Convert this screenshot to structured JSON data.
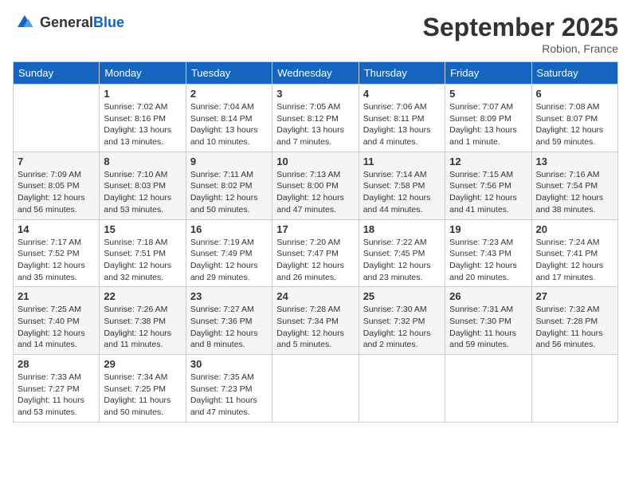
{
  "header": {
    "logo_general": "General",
    "logo_blue": "Blue",
    "month_title": "September 2025",
    "location": "Robion, France"
  },
  "days_of_week": [
    "Sunday",
    "Monday",
    "Tuesday",
    "Wednesday",
    "Thursday",
    "Friday",
    "Saturday"
  ],
  "weeks": [
    [
      {
        "day": "",
        "sunrise": "",
        "sunset": "",
        "daylight": ""
      },
      {
        "day": "1",
        "sunrise": "Sunrise: 7:02 AM",
        "sunset": "Sunset: 8:16 PM",
        "daylight": "Daylight: 13 hours and 13 minutes."
      },
      {
        "day": "2",
        "sunrise": "Sunrise: 7:04 AM",
        "sunset": "Sunset: 8:14 PM",
        "daylight": "Daylight: 13 hours and 10 minutes."
      },
      {
        "day": "3",
        "sunrise": "Sunrise: 7:05 AM",
        "sunset": "Sunset: 8:12 PM",
        "daylight": "Daylight: 13 hours and 7 minutes."
      },
      {
        "day": "4",
        "sunrise": "Sunrise: 7:06 AM",
        "sunset": "Sunset: 8:11 PM",
        "daylight": "Daylight: 13 hours and 4 minutes."
      },
      {
        "day": "5",
        "sunrise": "Sunrise: 7:07 AM",
        "sunset": "Sunset: 8:09 PM",
        "daylight": "Daylight: 13 hours and 1 minute."
      },
      {
        "day": "6",
        "sunrise": "Sunrise: 7:08 AM",
        "sunset": "Sunset: 8:07 PM",
        "daylight": "Daylight: 12 hours and 59 minutes."
      }
    ],
    [
      {
        "day": "7",
        "sunrise": "Sunrise: 7:09 AM",
        "sunset": "Sunset: 8:05 PM",
        "daylight": "Daylight: 12 hours and 56 minutes."
      },
      {
        "day": "8",
        "sunrise": "Sunrise: 7:10 AM",
        "sunset": "Sunset: 8:03 PM",
        "daylight": "Daylight: 12 hours and 53 minutes."
      },
      {
        "day": "9",
        "sunrise": "Sunrise: 7:11 AM",
        "sunset": "Sunset: 8:02 PM",
        "daylight": "Daylight: 12 hours and 50 minutes."
      },
      {
        "day": "10",
        "sunrise": "Sunrise: 7:13 AM",
        "sunset": "Sunset: 8:00 PM",
        "daylight": "Daylight: 12 hours and 47 minutes."
      },
      {
        "day": "11",
        "sunrise": "Sunrise: 7:14 AM",
        "sunset": "Sunset: 7:58 PM",
        "daylight": "Daylight: 12 hours and 44 minutes."
      },
      {
        "day": "12",
        "sunrise": "Sunrise: 7:15 AM",
        "sunset": "Sunset: 7:56 PM",
        "daylight": "Daylight: 12 hours and 41 minutes."
      },
      {
        "day": "13",
        "sunrise": "Sunrise: 7:16 AM",
        "sunset": "Sunset: 7:54 PM",
        "daylight": "Daylight: 12 hours and 38 minutes."
      }
    ],
    [
      {
        "day": "14",
        "sunrise": "Sunrise: 7:17 AM",
        "sunset": "Sunset: 7:52 PM",
        "daylight": "Daylight: 12 hours and 35 minutes."
      },
      {
        "day": "15",
        "sunrise": "Sunrise: 7:18 AM",
        "sunset": "Sunset: 7:51 PM",
        "daylight": "Daylight: 12 hours and 32 minutes."
      },
      {
        "day": "16",
        "sunrise": "Sunrise: 7:19 AM",
        "sunset": "Sunset: 7:49 PM",
        "daylight": "Daylight: 12 hours and 29 minutes."
      },
      {
        "day": "17",
        "sunrise": "Sunrise: 7:20 AM",
        "sunset": "Sunset: 7:47 PM",
        "daylight": "Daylight: 12 hours and 26 minutes."
      },
      {
        "day": "18",
        "sunrise": "Sunrise: 7:22 AM",
        "sunset": "Sunset: 7:45 PM",
        "daylight": "Daylight: 12 hours and 23 minutes."
      },
      {
        "day": "19",
        "sunrise": "Sunrise: 7:23 AM",
        "sunset": "Sunset: 7:43 PM",
        "daylight": "Daylight: 12 hours and 20 minutes."
      },
      {
        "day": "20",
        "sunrise": "Sunrise: 7:24 AM",
        "sunset": "Sunset: 7:41 PM",
        "daylight": "Daylight: 12 hours and 17 minutes."
      }
    ],
    [
      {
        "day": "21",
        "sunrise": "Sunrise: 7:25 AM",
        "sunset": "Sunset: 7:40 PM",
        "daylight": "Daylight: 12 hours and 14 minutes."
      },
      {
        "day": "22",
        "sunrise": "Sunrise: 7:26 AM",
        "sunset": "Sunset: 7:38 PM",
        "daylight": "Daylight: 12 hours and 11 minutes."
      },
      {
        "day": "23",
        "sunrise": "Sunrise: 7:27 AM",
        "sunset": "Sunset: 7:36 PM",
        "daylight": "Daylight: 12 hours and 8 minutes."
      },
      {
        "day": "24",
        "sunrise": "Sunrise: 7:28 AM",
        "sunset": "Sunset: 7:34 PM",
        "daylight": "Daylight: 12 hours and 5 minutes."
      },
      {
        "day": "25",
        "sunrise": "Sunrise: 7:30 AM",
        "sunset": "Sunset: 7:32 PM",
        "daylight": "Daylight: 12 hours and 2 minutes."
      },
      {
        "day": "26",
        "sunrise": "Sunrise: 7:31 AM",
        "sunset": "Sunset: 7:30 PM",
        "daylight": "Daylight: 11 hours and 59 minutes."
      },
      {
        "day": "27",
        "sunrise": "Sunrise: 7:32 AM",
        "sunset": "Sunset: 7:28 PM",
        "daylight": "Daylight: 11 hours and 56 minutes."
      }
    ],
    [
      {
        "day": "28",
        "sunrise": "Sunrise: 7:33 AM",
        "sunset": "Sunset: 7:27 PM",
        "daylight": "Daylight: 11 hours and 53 minutes."
      },
      {
        "day": "29",
        "sunrise": "Sunrise: 7:34 AM",
        "sunset": "Sunset: 7:25 PM",
        "daylight": "Daylight: 11 hours and 50 minutes."
      },
      {
        "day": "30",
        "sunrise": "Sunrise: 7:35 AM",
        "sunset": "Sunset: 7:23 PM",
        "daylight": "Daylight: 11 hours and 47 minutes."
      },
      {
        "day": "",
        "sunrise": "",
        "sunset": "",
        "daylight": ""
      },
      {
        "day": "",
        "sunrise": "",
        "sunset": "",
        "daylight": ""
      },
      {
        "day": "",
        "sunrise": "",
        "sunset": "",
        "daylight": ""
      },
      {
        "day": "",
        "sunrise": "",
        "sunset": "",
        "daylight": ""
      }
    ]
  ]
}
